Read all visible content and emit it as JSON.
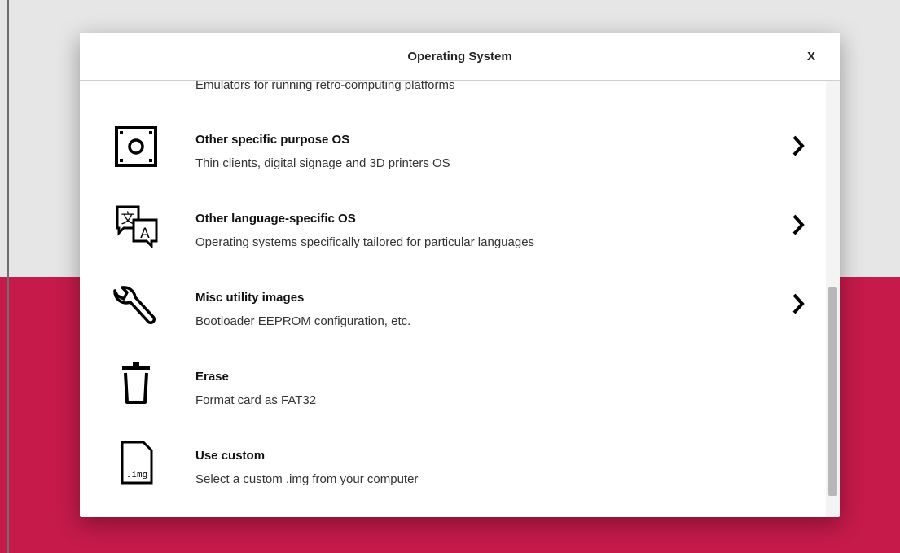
{
  "dialog": {
    "title": "Operating System",
    "close_label": "X"
  },
  "items": [
    {
      "title": "",
      "desc": "Emulators for running retro-computing platforms",
      "icon": "game-controller-icon",
      "has_arrow": false
    },
    {
      "title": "Other specific purpose OS",
      "desc": "Thin clients, digital signage and 3D printers OS",
      "icon": "device-icon",
      "has_arrow": true
    },
    {
      "title": "Other language-specific OS",
      "desc": "Operating systems specifically tailored for particular languages",
      "icon": "translate-icon",
      "has_arrow": true
    },
    {
      "title": "Misc utility images",
      "desc": "Bootloader EEPROM configuration, etc.",
      "icon": "wrench-icon",
      "has_arrow": true
    },
    {
      "title": "Erase",
      "desc": "Format card as FAT32",
      "icon": "trash-icon",
      "has_arrow": false
    },
    {
      "title": "Use custom",
      "desc": "Select a custom .img from your computer",
      "icon": "image-file-icon",
      "icon_text": ".img",
      "has_arrow": false
    }
  ],
  "colors": {
    "accent": "#c51a4a",
    "background": "#e6e6e6"
  }
}
